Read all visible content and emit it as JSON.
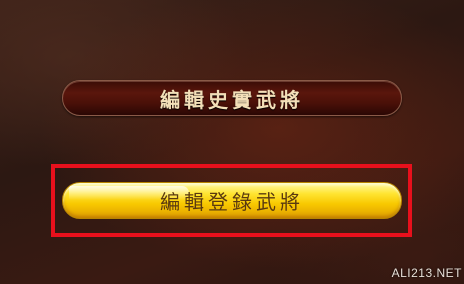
{
  "menu": {
    "edit_historical_label": "編輯史實武將",
    "edit_registered_label": "編輯登錄武將"
  },
  "highlight": {
    "color": "#e8101c"
  },
  "watermark": {
    "text": "ALI213.NET"
  },
  "colors": {
    "historical_button": "#4a1008",
    "registered_button": "#f8c800",
    "historical_text": "#f3dfb8",
    "registered_text": "#5a3a10"
  }
}
